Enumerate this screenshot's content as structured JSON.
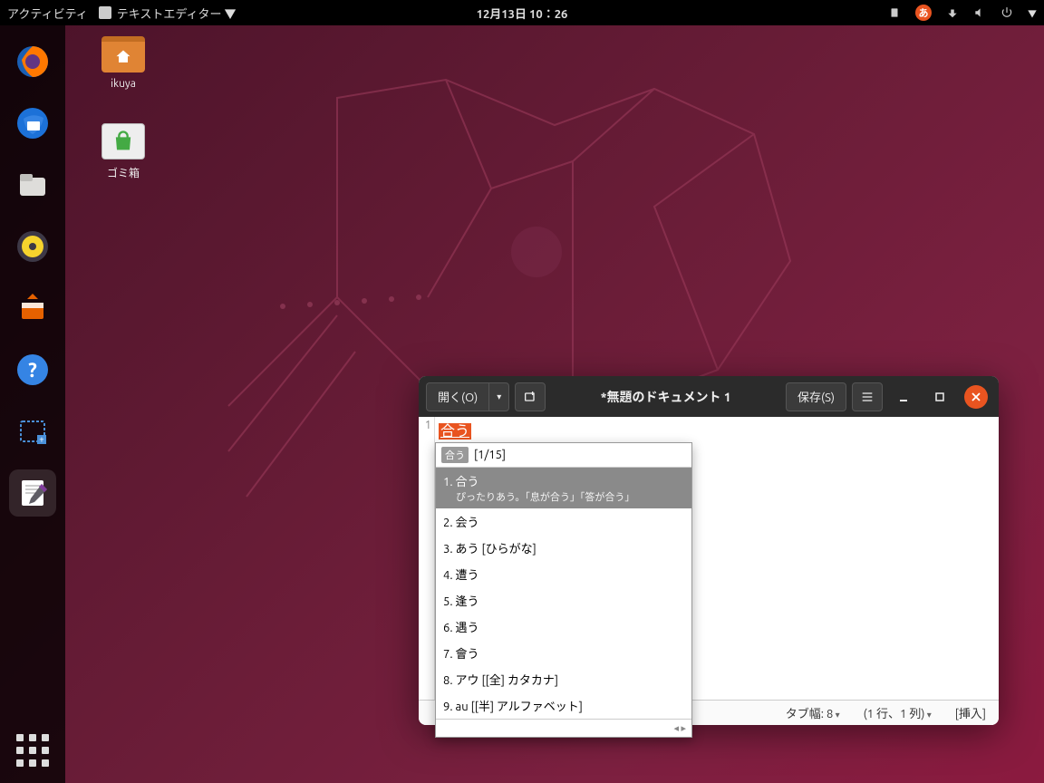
{
  "topbar": {
    "activities": "アクティビティ",
    "app_name": "テキストエディター ▼",
    "clock": "12月13日 10：26",
    "ime_badge": "あ"
  },
  "desktop": {
    "home_label": "ikuya",
    "trash_label": "ゴミ箱"
  },
  "dock": {
    "items": [
      "firefox",
      "thunderbird",
      "files",
      "rhythmbox",
      "software",
      "help",
      "screenshot",
      "text-editor"
    ]
  },
  "window": {
    "open_label": "開く(O)",
    "save_label": "保存(S)",
    "title": "*無題のドキュメント 1"
  },
  "editor": {
    "line_number": "1",
    "composing_text": "合う"
  },
  "ime": {
    "head_chip": "合う",
    "head_count": "[1/15]",
    "candidates": [
      {
        "n": "1",
        "t": "合う",
        "sub": "ぴったりあう。「息が合う」「答が合う」",
        "selected": true
      },
      {
        "n": "2",
        "t": "会う"
      },
      {
        "n": "3",
        "t": "あう [ひらがな]"
      },
      {
        "n": "4",
        "t": "遭う"
      },
      {
        "n": "5",
        "t": "逢う"
      },
      {
        "n": "6",
        "t": "遇う"
      },
      {
        "n": "7",
        "t": "會う"
      },
      {
        "n": "8",
        "t": "アウ [[全] カタカナ]"
      },
      {
        "n": "9",
        "t": "au [[半] アルファベット]"
      }
    ],
    "foot_nav": "◂ ▸"
  },
  "statusbar": {
    "tab_width": "タブ幅: 8",
    "position": "(1 行、1 列)",
    "mode": "[挿入]"
  }
}
